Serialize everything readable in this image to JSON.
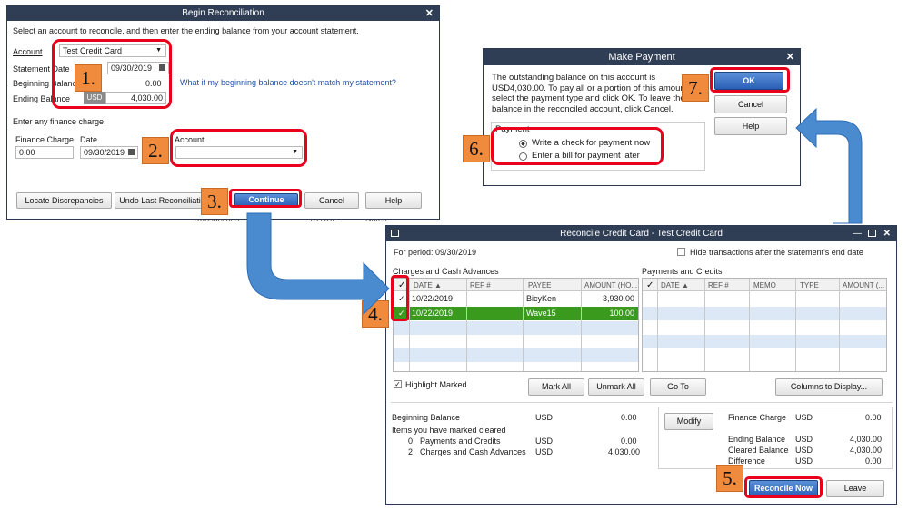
{
  "begin": {
    "title": "Begin Reconciliation",
    "instruction": "Select an account to reconcile, and then enter the ending balance from your account statement.",
    "account_label": "Account",
    "account_value": "Test Credit Card",
    "statement_date_label": "Statement Date",
    "statement_date": "09/30/2019",
    "beginning_balance_label": "Beginning Balance",
    "beginning_balance": "0.00",
    "ending_balance_label": "Ending Balance",
    "currency": "USD",
    "ending_balance": "4,030.00",
    "help_link": "What if my beginning balance doesn't match my statement?",
    "finance_prompt": "Enter any finance charge.",
    "finance_charge_label": "Finance Charge",
    "finance_charge": "0.00",
    "date_label": "Date",
    "finance_date": "09/30/2019",
    "account2_label": "Account",
    "account2_value": "",
    "btn_locate": "Locate Discrepancies",
    "btn_undo": "Undo Last Reconciliation",
    "btn_continue": "Continue",
    "btn_cancel": "Cancel",
    "btn_help": "Help"
  },
  "payment": {
    "title": "Make Payment",
    "message": "The outstanding balance on this account is USD4,030.00. To pay all or a portion of this amount, select the payment type and click OK. To leave the balance in the reconciled account, click Cancel.",
    "group_label": "Payment",
    "option_check": "Write a check for payment now",
    "option_bill": "Enter a bill for payment later",
    "btn_ok": "OK",
    "btn_cancel": "Cancel",
    "btn_help": "Help"
  },
  "reconcile": {
    "title": "Reconcile Credit Card - Test Credit Card",
    "period": "For period: 09/30/2019",
    "hide_label": "Hide transactions after the statement's end date",
    "charges_title": "Charges and Cash Advances",
    "payments_title": "Payments and Credits",
    "charges_cols": [
      "✓",
      "DATE ▲",
      "REF #",
      "PAYEE",
      "AMOUNT (HO..."
    ],
    "payments_cols": [
      "✓",
      "DATE ▲",
      "REF #",
      "MEMO",
      "TYPE",
      "AMOUNT (..."
    ],
    "charges_rows": [
      {
        "check": "✓",
        "date": "10/22/2019",
        "ref": "",
        "payee": "BicyKen",
        "amount": "3,930.00"
      },
      {
        "check": "✓",
        "date": "10/22/2019",
        "ref": "",
        "payee": "Wave15",
        "amount": "100.00"
      }
    ],
    "highlight_label": "Highlight Marked",
    "btn_mark_all": "Mark All",
    "btn_unmark_all": "Unmark All",
    "btn_goto": "Go To",
    "btn_columns": "Columns to Display...",
    "beginning_balance_label": "Beginning Balance",
    "beginning_balance_cur": "USD",
    "beginning_balance": "0.00",
    "marked_cleared_label": "Items you have marked cleared",
    "pay_count": "0",
    "pay_label": "Payments and Credits",
    "pay_cur": "USD",
    "pay_amount": "0.00",
    "chg_count": "2",
    "chg_label": "Charges and Cash Advances",
    "chg_cur": "USD",
    "chg_amount": "4,030.00",
    "btn_modify": "Modify",
    "finance_label": "Finance Charge",
    "finance_cur": "USD",
    "finance_amount": "0.00",
    "ending_label": "Ending Balance",
    "ending_cur": "USD",
    "ending_amount": "4,030.00",
    "cleared_label": "Cleared Balance",
    "cleared_cur": "USD",
    "cleared_amount": "4,030.00",
    "difference_label": "Difference",
    "difference_cur": "USD",
    "difference_amount": "0.00",
    "btn_reconcile": "Reconcile Now",
    "btn_leave": "Leave"
  },
  "background": {
    "text1": "Transactions",
    "text2": "13 DUE",
    "text3": "Notes"
  },
  "steps": [
    "1.",
    "2.",
    "3.",
    "4.",
    "5.",
    "6.",
    "7."
  ],
  "colors": {
    "titlebar": "#2f3e55",
    "annotation_red": "#e8001c",
    "step_orange": "#f08a3c",
    "arrow_blue": "#4a8bd0",
    "selected_green": "#3a9a1e"
  }
}
